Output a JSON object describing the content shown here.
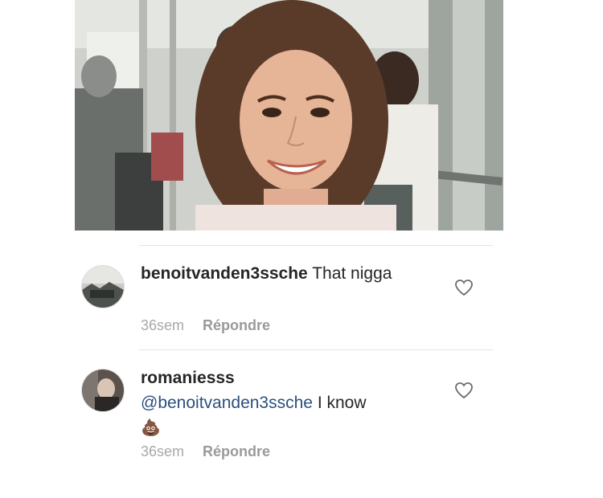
{
  "comments": [
    {
      "username": "benoitvanden3ssche",
      "mention": "",
      "text": "That nigga",
      "emoji": "",
      "time": "36sem",
      "reply_label": "Répondre",
      "avatar_icon": "landscape-avatar",
      "like_icon": "heart-outline-icon"
    },
    {
      "username": "romaniesss",
      "mention": "@benoitvanden3ssche",
      "text": "I know",
      "emoji": "💩",
      "time": "36sem",
      "reply_label": "Répondre",
      "avatar_icon": "person-avatar",
      "like_icon": "heart-outline-icon"
    }
  ],
  "colors": {
    "text": "#262626",
    "mention": "#2b4f7e",
    "meta": "#a8a8a8",
    "divider": "#e3e3e3"
  }
}
